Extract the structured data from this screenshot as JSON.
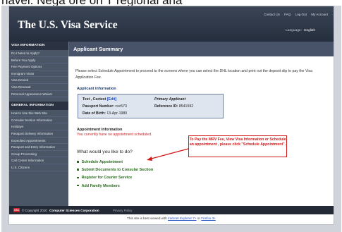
{
  "cutoff_text": "navel. Nega ore on T regional ana",
  "header": {
    "title": "The U.S. Visa Service",
    "links": [
      "Contact Us",
      "FAQ",
      "Log Out",
      "My Account"
    ],
    "language_label": "Language:",
    "language_value": "English"
  },
  "sidebar": {
    "section1": "VISA INFORMATION",
    "items1": [
      "Do I Need to Apply?",
      "Before You Apply",
      "Fee Payment Options",
      "Immigrant Visas",
      "Visa Denied",
      "Visa Renewal",
      "Personal Appearance Waiver"
    ],
    "section2": "GENERAL INFORMATION",
    "items2": [
      "How to Use this Web Site",
      "Consular Section Information",
      "Holidays",
      "Passport Delivery Information",
      "Expedited Appointments",
      "Passport and Entry Information",
      "Group Processing",
      "Call Center Information",
      "U.S. Citizens"
    ]
  },
  "main": {
    "page_title": "Applicant Summary",
    "intro": "Please select Schedule Appointment to proceed to the screens where you can select the DHL location and print out the deposit slip to pay the Visa Application Fee.",
    "applicant_info_title": "Applicant Information",
    "applicant_name": "Test , Csctest",
    "edit_label": "[Edit]",
    "primary_label": "Primary Applicant",
    "passport_label": "Passport Number:",
    "passport_value": "csc573",
    "reference_label": "Reference ID:",
    "reference_value": "8541592",
    "dob_label": "Date of Birth:",
    "dob_value": "13-Apr-1980",
    "appointment_title": "Appointment Information",
    "no_appointment": "You currently have no appointment scheduled.",
    "todo_heading": "What would you like to do?",
    "callout": "To Pay the MRV Fee, View Visa Information or Schedule an appointment , please click \"Schedule Appointment\".",
    "actions": [
      "Schedule Appointment",
      "Submit Documents to Consular Section",
      "Register for Courier Service",
      "Add Family Members"
    ]
  },
  "footer": {
    "logo_text": "CSC",
    "copyright": "© Copyright 2010",
    "company": "Computer Sciences Corporation",
    "privacy": "Privacy Policy",
    "browser_note_prefix": "This site is best viewed with",
    "browser_ie": "Internet Explorer 7+",
    "browser_or": "or",
    "browser_ff": "Firefox 3+"
  },
  "colors": {
    "header_bg": "#2f3a4b",
    "sidebar_bg": "#4a5566",
    "callout_red": "#d21a1a",
    "action_green": "#2a6b1f",
    "heading_blue": "#1c3b6e"
  }
}
